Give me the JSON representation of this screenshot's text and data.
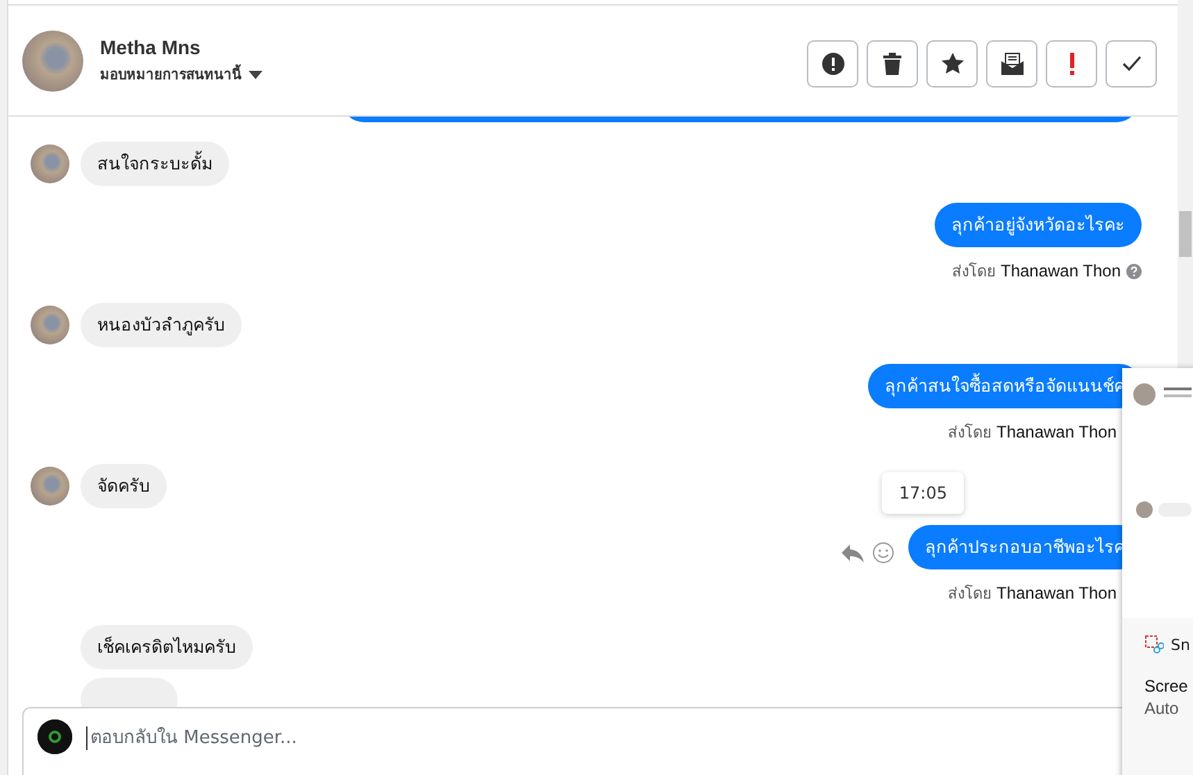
{
  "header": {
    "name": "Metha Mns",
    "assign_label": "มอบหมายการสนทนานี้"
  },
  "messages": [
    {
      "kind": "fragment_out"
    },
    {
      "kind": "incoming",
      "text": "สนใจกระบะดั้ม"
    },
    {
      "kind": "outgoing",
      "text": "ลุกค้าอยู่จังหวัดอะไรคะ"
    },
    {
      "kind": "sent_by",
      "prefix": "ส่งโดย",
      "sender": "Thanawan Thon",
      "help": true
    },
    {
      "kind": "incoming",
      "text": "หนองบัวลำภูครับ"
    },
    {
      "kind": "outgoing",
      "text": "ลุกค้าสนใจซื้อสดหรือจัดแนนช์ค"
    },
    {
      "kind": "sent_by",
      "prefix": "ส่งโดย",
      "sender": "Thanawan Thon",
      "help": false
    },
    {
      "kind": "incoming",
      "text": "จัดครับ"
    },
    {
      "kind": "outgoing",
      "text": "ลุกค้าประกอบอาชีพอะไรค",
      "time": "17:05",
      "hover": true
    },
    {
      "kind": "sent_by",
      "prefix": "ส่งโดย",
      "sender": "Thanawan Thon",
      "help": false
    },
    {
      "kind": "incoming_plain",
      "text": "เช็คเครดิตไหมครับ"
    },
    {
      "kind": "fragment_in"
    }
  ],
  "composer": {
    "placeholder": "ตอบกลับใน Messenger..."
  },
  "notification": {
    "app": "Sn",
    "title": "Scree",
    "body": "Auto"
  }
}
